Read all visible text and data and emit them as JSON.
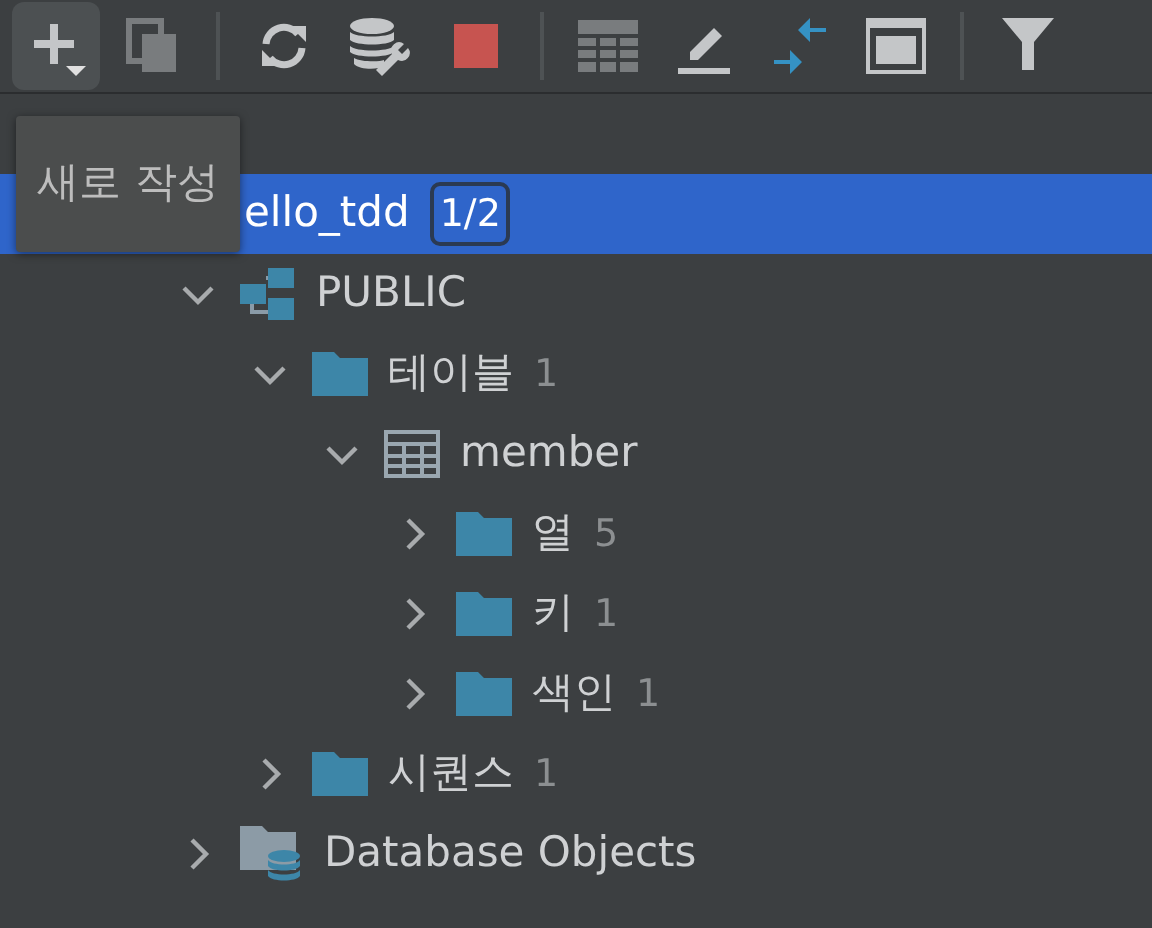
{
  "toolbar": {
    "groups": [
      [
        {
          "kind": "add",
          "hovered": true,
          "disabled": false
        },
        {
          "kind": "copy",
          "hovered": false,
          "disabled": true
        }
      ],
      [
        {
          "kind": "refresh",
          "hovered": false,
          "disabled": false
        },
        {
          "kind": "db-tools",
          "hovered": false,
          "disabled": false
        },
        {
          "kind": "stop",
          "hovered": false,
          "disabled": false
        }
      ],
      [
        {
          "kind": "table",
          "hovered": false,
          "disabled": true
        },
        {
          "kind": "edit",
          "hovered": false,
          "disabled": false
        },
        {
          "kind": "collapse",
          "hovered": false,
          "disabled": false
        },
        {
          "kind": "console",
          "hovered": false,
          "disabled": false
        }
      ],
      [
        {
          "kind": "filter",
          "hovered": false,
          "disabled": false
        }
      ]
    ]
  },
  "tree": [
    {
      "children": [
        {
          "label": "ello_tdd",
          "count": "1/2",
          "count_boxed": true,
          "selected": true,
          "children": [
            {
              "kind": "schema",
              "label": "PUBLIC",
              "selected": false,
              "expanded": true,
              "children": [
                {
                  "kind": "folder",
                  "label": "테이블",
                  "count": "1",
                  "count_boxed": false,
                  "selected": false,
                  "expanded": true,
                  "children": [
                    {
                      "kind": "table",
                      "label": "member",
                      "selected": false,
                      "expanded": true,
                      "children": [
                        {
                          "kind": "folder",
                          "label": "열",
                          "count": "5",
                          "count_boxed": false,
                          "selected": false,
                          "expanded": false
                        },
                        {
                          "kind": "folder",
                          "label": "키",
                          "count": "1",
                          "count_boxed": false,
                          "selected": false,
                          "expanded": false
                        },
                        {
                          "kind": "folder",
                          "label": "색인",
                          "count": "1",
                          "count_boxed": false,
                          "selected": false,
                          "expanded": false
                        }
                      ]
                    }
                  ]
                },
                {
                  "kind": "folder",
                  "label": "시퀀스",
                  "count": "1",
                  "count_boxed": false,
                  "selected": false,
                  "expanded": false
                }
              ]
            },
            {
              "kind": "db-objects",
              "label": "Database Objects",
              "selected": false,
              "expanded": false
            }
          ]
        }
      ]
    }
  ],
  "tooltip": {
    "text": "새로 작성"
  }
}
